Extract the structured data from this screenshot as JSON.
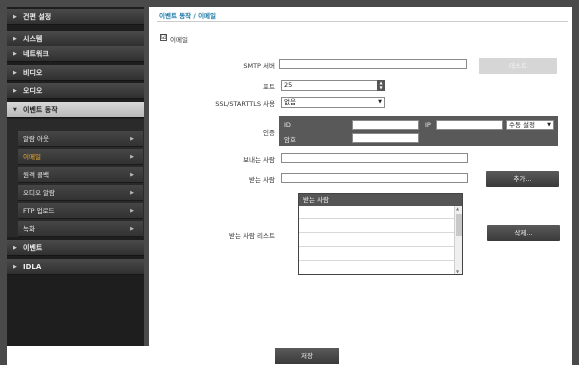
{
  "sidebar": {
    "items_top": [
      "건편 설정",
      "시스템",
      "네트워크",
      "비디오",
      "오디오"
    ],
    "active_item": "이벤트 동작",
    "submenu": [
      "알람 아웃",
      "이메일",
      "원격 콜백",
      "오디오 알람",
      "FTP 업로드",
      "녹화"
    ],
    "current_submenu": "이메일",
    "items_bottom": [
      "이벤트",
      "IDLA"
    ]
  },
  "main": {
    "breadcrumb": "이벤트 동작 / 이메일",
    "email_checkbox_label": "이메일",
    "email_checked": "☑",
    "smtp_label": "SMTP 서버",
    "smtp_value": "",
    "test_button": "테스트",
    "port_label": "포트",
    "port_value": "25",
    "ssl_label": "SSL/STARTTLS 사용",
    "ssl_value": "없음",
    "auth_label": "인증",
    "auth_id_label": "ID",
    "auth_ip_label": "IP",
    "auth_mode_value": "수동 설정",
    "auth_pw_label": "암호",
    "sender_label": "보내는 사람",
    "recipient_label": "받는 사람",
    "add_button": "추가...",
    "recipient_list_label": "받는 사람 리스트",
    "recipient_list_header": "받는 사람",
    "delete_button": "삭제..."
  },
  "footer": {
    "save_button": "저장"
  }
}
